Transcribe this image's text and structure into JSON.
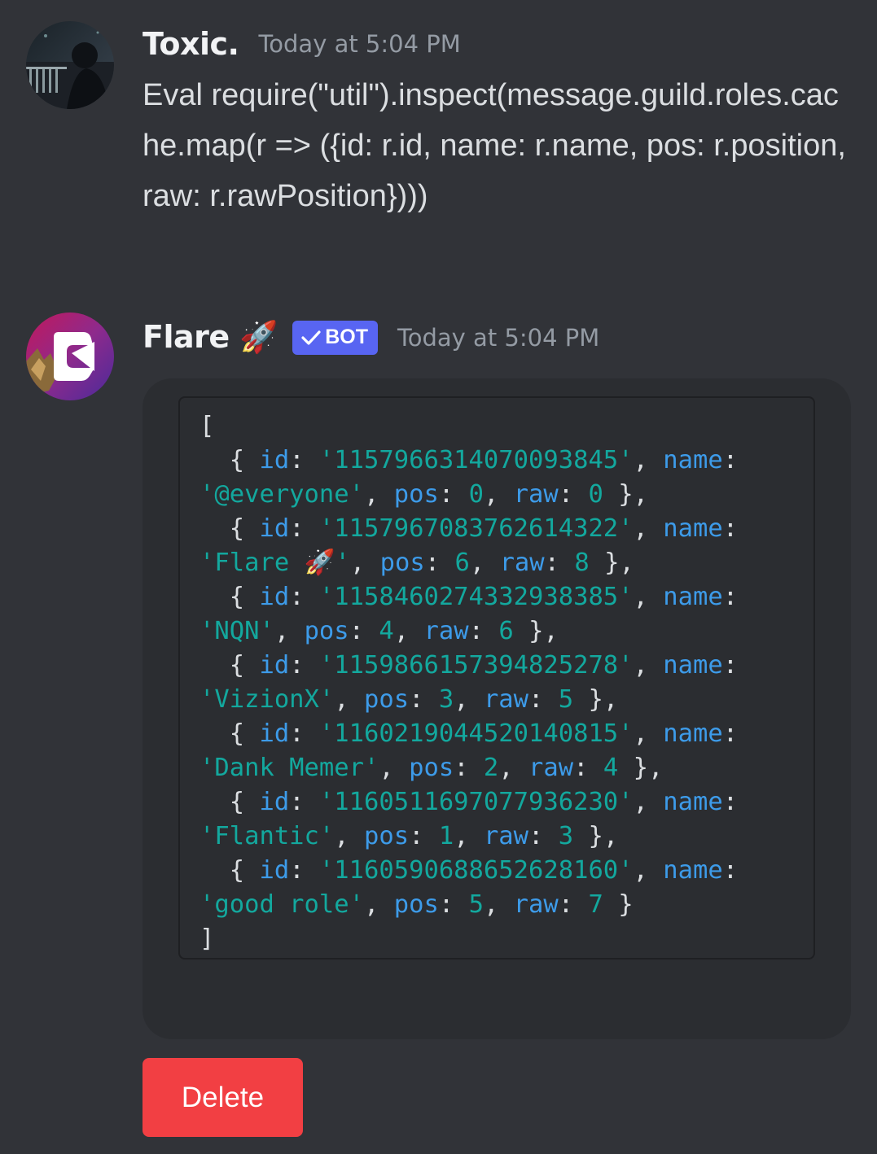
{
  "messages": [
    {
      "author": "Toxic.",
      "timestamp": "Today at 5:04 PM",
      "text": "Eval require(\"util\").inspect(message.guild.roles.cache.map(r => ({id: r.id, name: r.name, pos: r.position, raw: r.rawPosition})))"
    },
    {
      "author": "Flare 🚀",
      "badge": "BOT",
      "timestamp": "Today at 5:04 PM",
      "code_open": "[",
      "code_close": "]",
      "roles": [
        {
          "id": "1157966314070093845",
          "name": "@everyone",
          "pos": "0",
          "raw": "0"
        },
        {
          "id": "1157967083762614322",
          "name": "Flare 🚀",
          "pos": "6",
          "raw": "8"
        },
        {
          "id": "1158460274332938385",
          "name": "NQN",
          "pos": "4",
          "raw": "6"
        },
        {
          "id": "1159866157394825278",
          "name": "VizionX",
          "pos": "3",
          "raw": "5"
        },
        {
          "id": "1160219044520140815",
          "name": "Dank Memer",
          "pos": "2",
          "raw": "4"
        },
        {
          "id": "1160511697077936230",
          "name": "Flantic",
          "pos": "1",
          "raw": "3"
        },
        {
          "id": "1160590688652628160",
          "name": "good role",
          "pos": "5",
          "raw": "7"
        }
      ]
    }
  ],
  "actions": {
    "delete_label": "Delete"
  },
  "colors": {
    "background": "#313338",
    "embed": "#2b2d31",
    "bot_badge": "#5865f2",
    "delete_button": "#f23f43",
    "code_key": "#3d9be9",
    "code_string": "#13a89e"
  }
}
